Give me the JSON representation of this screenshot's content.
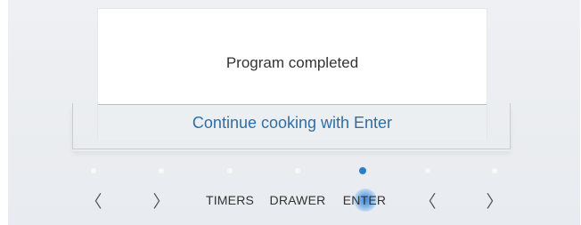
{
  "display": {
    "message": "Program completed",
    "hint": "Continue cooking with Enter"
  },
  "controls": {
    "left_icon": "〈",
    "right_icon": "〉",
    "timers": "TIMERS",
    "drawer": "DRAWER",
    "enter": "ENTER",
    "active_indicator": "enter"
  },
  "colors": {
    "accent": "#2b7ec9",
    "hint_text": "#2f6ea3",
    "panel_bg": "#eceff2"
  }
}
